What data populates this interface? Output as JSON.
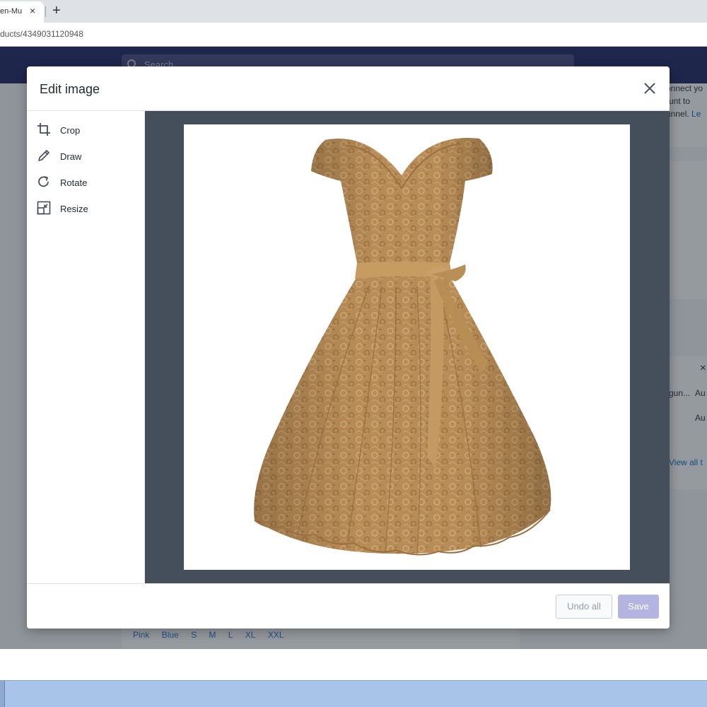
{
  "browser": {
    "tab_title": "en-Mu",
    "tab_close": "×",
    "new_tab": "+",
    "url": "ducts/4349031120948"
  },
  "admin": {
    "search_placeholder": "Search",
    "right_panel": {
      "line1": "onnect yo",
      "line2": "unt to",
      "line3": "annel.",
      "line3_link": "Le",
      "close_glyph": "×",
      "row1_a": "gun...",
      "row1_b": "Au",
      "row2": "Au",
      "view_all": "View all t"
    },
    "variant_options": [
      "Pink",
      "Blue",
      "S",
      "M",
      "L",
      "XL",
      "XXL"
    ]
  },
  "modal": {
    "title": "Edit image",
    "tools": [
      {
        "label": "Crop",
        "icon": "crop-icon"
      },
      {
        "label": "Draw",
        "icon": "pencil-icon"
      },
      {
        "label": "Rotate",
        "icon": "rotate-icon"
      },
      {
        "label": "Resize",
        "icon": "resize-icon"
      }
    ],
    "image": {
      "subject": "lace-dress",
      "color": "#b58a55",
      "ribbon_color": "#c49a62"
    },
    "buttons": {
      "undo_all": "Undo all",
      "save": "Save"
    }
  },
  "colors": {
    "admin_topbar": "#1c2260",
    "canvas_bg": "#454f5b",
    "save_disabled": "#b3b5e0"
  }
}
